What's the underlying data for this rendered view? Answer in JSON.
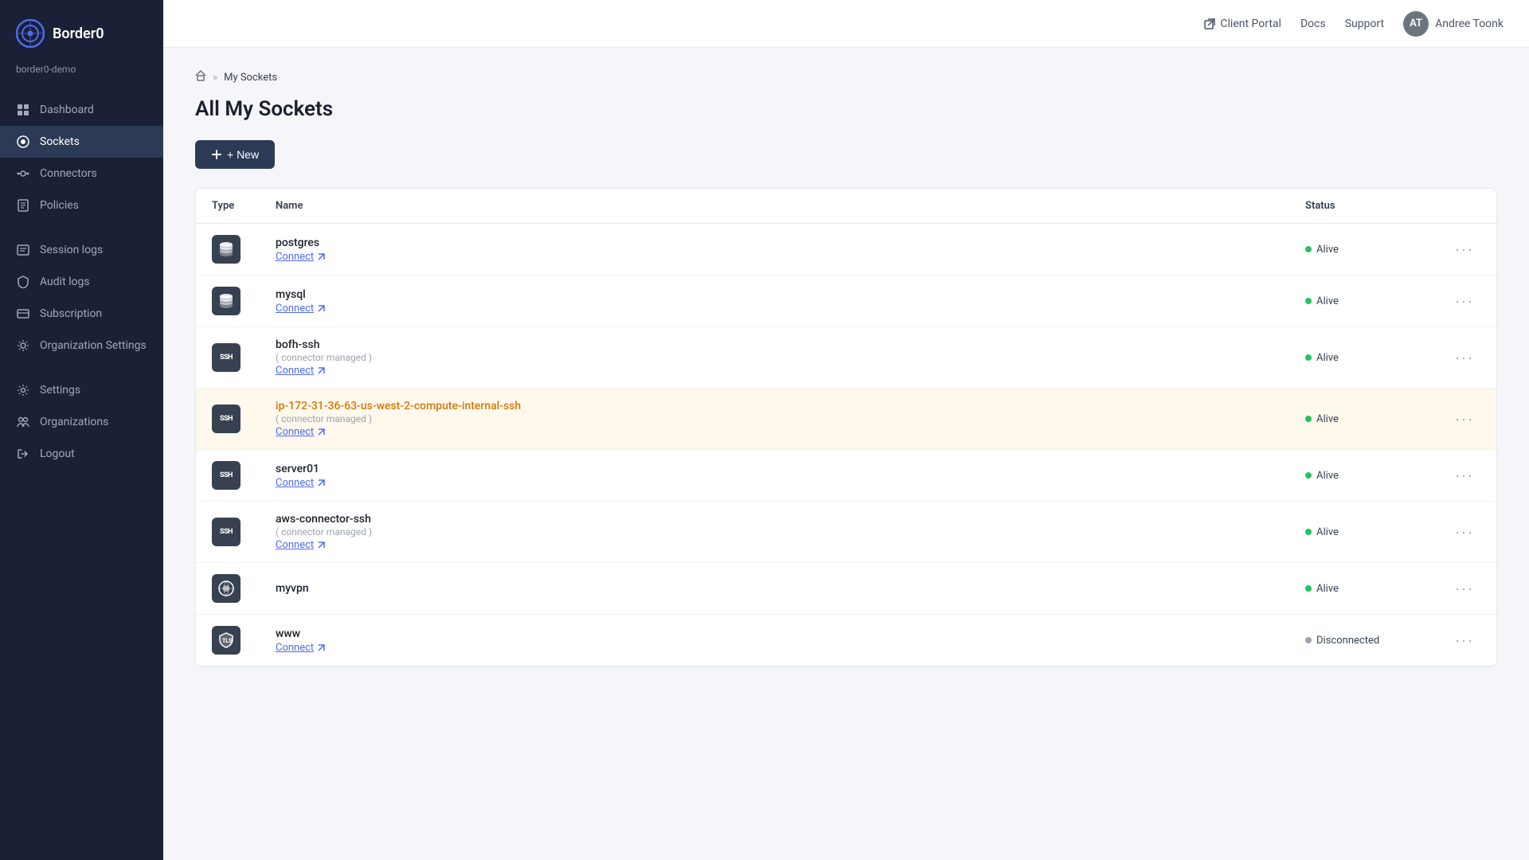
{
  "app": {
    "logo_text": "Border0",
    "org": "border0-demo"
  },
  "topbar": {
    "client_portal": "Client Portal",
    "docs": "Docs",
    "support": "Support",
    "user": "Andree Toonk"
  },
  "breadcrumb": {
    "home_icon": "home-icon",
    "separator": "»",
    "current": "My Sockets"
  },
  "page": {
    "title": "All My Sockets",
    "new_button": "+ New"
  },
  "table": {
    "headers": [
      "Type",
      "Name",
      "Status"
    ],
    "rows": [
      {
        "type": "db",
        "type_label": "DB",
        "name": "postgres",
        "sub": "",
        "connect_label": "Connect",
        "status": "Alive",
        "status_type": "alive",
        "highlighted": false
      },
      {
        "type": "db",
        "type_label": "DB",
        "name": "mysql",
        "sub": "",
        "connect_label": "Connect",
        "status": "Alive",
        "status_type": "alive",
        "highlighted": false
      },
      {
        "type": "ssh",
        "type_label": "SSH",
        "name": "bofh-ssh",
        "sub": "( connector managed )",
        "connect_label": "Connect",
        "status": "Alive",
        "status_type": "alive",
        "highlighted": false
      },
      {
        "type": "ssh",
        "type_label": "SSH",
        "name": "ip-172-31-36-63-us-west-2-compute-internal-ssh",
        "sub": "( connector managed )",
        "connect_label": "Connect",
        "status": "Alive",
        "status_type": "alive",
        "highlighted": true
      },
      {
        "type": "ssh",
        "type_label": "SSH",
        "name": "server01",
        "sub": "",
        "connect_label": "Connect",
        "status": "Alive",
        "status_type": "alive",
        "highlighted": false
      },
      {
        "type": "ssh",
        "type_label": "SSH",
        "name": "aws-connector-ssh",
        "sub": "( connector managed )",
        "connect_label": "Connect",
        "status": "Alive",
        "status_type": "alive",
        "highlighted": false
      },
      {
        "type": "vpn",
        "type_label": "VPN",
        "name": "myvpn",
        "sub": "",
        "connect_label": "",
        "status": "Alive",
        "status_type": "alive",
        "highlighted": false
      },
      {
        "type": "tls",
        "type_label": "TLS",
        "name": "www",
        "sub": "",
        "connect_label": "Connect",
        "status": "Disconnected",
        "status_type": "disconnected",
        "highlighted": false
      }
    ]
  },
  "sidebar": {
    "items": [
      {
        "label": "Dashboard",
        "icon": "dashboard-icon",
        "active": false
      },
      {
        "label": "Sockets",
        "icon": "sockets-icon",
        "active": true
      },
      {
        "label": "Connectors",
        "icon": "connectors-icon",
        "active": false
      },
      {
        "label": "Policies",
        "icon": "policies-icon",
        "active": false
      },
      {
        "label": "Session logs",
        "icon": "session-logs-icon",
        "active": false
      },
      {
        "label": "Audit logs",
        "icon": "audit-logs-icon",
        "active": false
      },
      {
        "label": "Subscription",
        "icon": "subscription-icon",
        "active": false
      },
      {
        "label": "Organization Settings",
        "icon": "org-settings-icon",
        "active": false
      },
      {
        "label": "Settings",
        "icon": "settings-icon",
        "active": false
      },
      {
        "label": "Organizations",
        "icon": "organizations-icon",
        "active": false
      },
      {
        "label": "Logout",
        "icon": "logout-icon",
        "active": false
      }
    ]
  }
}
